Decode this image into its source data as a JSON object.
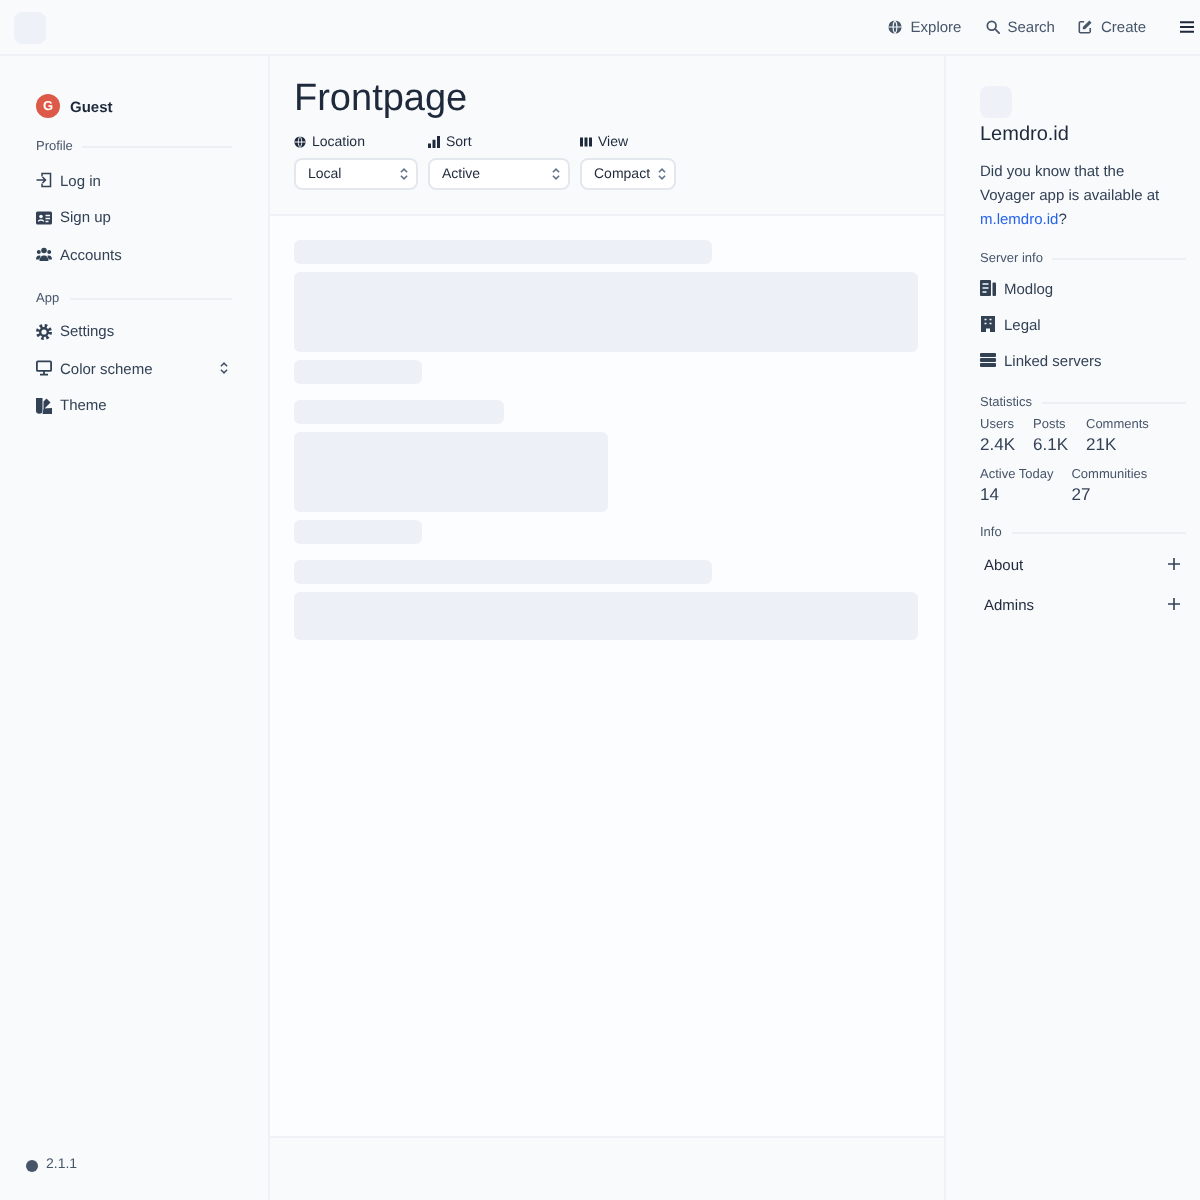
{
  "topbar": {
    "nav": [
      {
        "label": "Explore"
      },
      {
        "label": "Search"
      },
      {
        "label": "Create"
      }
    ]
  },
  "sidebar": {
    "user": {
      "initial": "G",
      "name": "Guest"
    },
    "sections": [
      {
        "title": "Profile",
        "items": [
          {
            "label": "Log in",
            "kind": "link"
          },
          {
            "label": "Sign up",
            "kind": "link"
          },
          {
            "label": "Accounts",
            "kind": "link"
          }
        ]
      },
      {
        "title": "App",
        "items": [
          {
            "label": "Settings",
            "kind": "link"
          },
          {
            "label": "Color scheme",
            "kind": "select"
          },
          {
            "label": "Theme",
            "kind": "link"
          }
        ]
      }
    ],
    "version": "2.1.1"
  },
  "main": {
    "title": "Frontpage",
    "filters": [
      {
        "label": "Location",
        "value": "Local"
      },
      {
        "label": "Sort",
        "value": "Active"
      },
      {
        "label": "View",
        "value": "Compact"
      }
    ],
    "feed": {
      "loading": true
    }
  },
  "aside": {
    "name": "Lemdro.id",
    "description": {
      "text": "Did you know that the Voyager app is available at",
      "link": "m.lemdro.id",
      "suffix": "?"
    },
    "server_info": {
      "title": "Server info",
      "items": [
        {
          "label": "Modlog"
        },
        {
          "label": "Legal"
        },
        {
          "label": "Linked servers"
        }
      ]
    },
    "statistics": {
      "title": "Statistics",
      "items": [
        {
          "label": "Users",
          "value": "2.4K"
        },
        {
          "label": "Posts",
          "value": "6.1K"
        },
        {
          "label": "Comments",
          "value": "21K"
        },
        {
          "label": "Active Today",
          "value": "14"
        },
        {
          "label": "Communities",
          "value": "27"
        }
      ]
    },
    "info": {
      "title": "Info",
      "items": [
        {
          "label": "About",
          "expanded": false
        },
        {
          "label": "Admins",
          "expanded": false
        }
      ]
    }
  }
}
